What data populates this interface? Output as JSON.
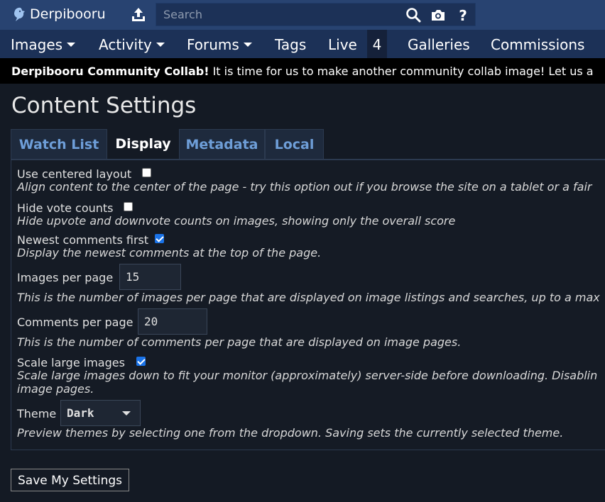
{
  "header": {
    "site_name": "Derpibooru",
    "search_placeholder": "Search",
    "search_value": ""
  },
  "nav": {
    "images": "Images",
    "activity": "Activity",
    "forums": "Forums",
    "tags": "Tags",
    "live": "Live",
    "live_count": "4",
    "galleries": "Galleries",
    "commissions": "Commissions"
  },
  "notice": {
    "title": "Derpibooru Community Collab!",
    "text": " It is time for us to make another community collab image! Let us a"
  },
  "page_title": "Content Settings",
  "tabs": [
    "Watch List",
    "Display",
    "Metadata",
    "Local"
  ],
  "active_tab": "Display",
  "settings": {
    "centered_layout": {
      "label": "Use centered layout",
      "checked": false,
      "help": "Align content to the center of the page - try this option out if you browse the site on a tablet or a fair"
    },
    "hide_vote_counts": {
      "label": "Hide vote counts",
      "checked": false,
      "help": "Hide upvote and downvote counts on images, showing only the overall score"
    },
    "newest_comments_first": {
      "label": "Newest comments first",
      "checked": true,
      "help": "Display the newest comments at the top of the page."
    },
    "images_per_page": {
      "label": "Images per page",
      "value": "15",
      "help": "This is the number of images per page that are displayed on image listings and searches, up to a max"
    },
    "comments_per_page": {
      "label": "Comments per page",
      "value": "20",
      "help": "This is the number of comments per page that are displayed on image pages."
    },
    "scale_large_images": {
      "label": "Scale large images",
      "checked": true,
      "help_line1": "Scale large images down to fit your monitor (approximately) server-side before downloading. Disablin",
      "help_line2": "image pages."
    },
    "theme": {
      "label": "Theme",
      "value": "Dark",
      "help": "Preview themes by selecting one from the dropdown. Saving sets the currently selected theme."
    }
  },
  "save_button": "Save My Settings",
  "colors": {
    "header_bg": "#284371",
    "nav_bg": "#1c3157",
    "page_bg": "#141a24",
    "link_blue": "#6e9ed8",
    "checkbox_blue": "#1a73e8"
  },
  "icons": {
    "logo": "pony-logo-icon",
    "upload": "upload-icon",
    "search": "search-icon",
    "camera": "camera-icon",
    "help": "question-mark-icon"
  }
}
